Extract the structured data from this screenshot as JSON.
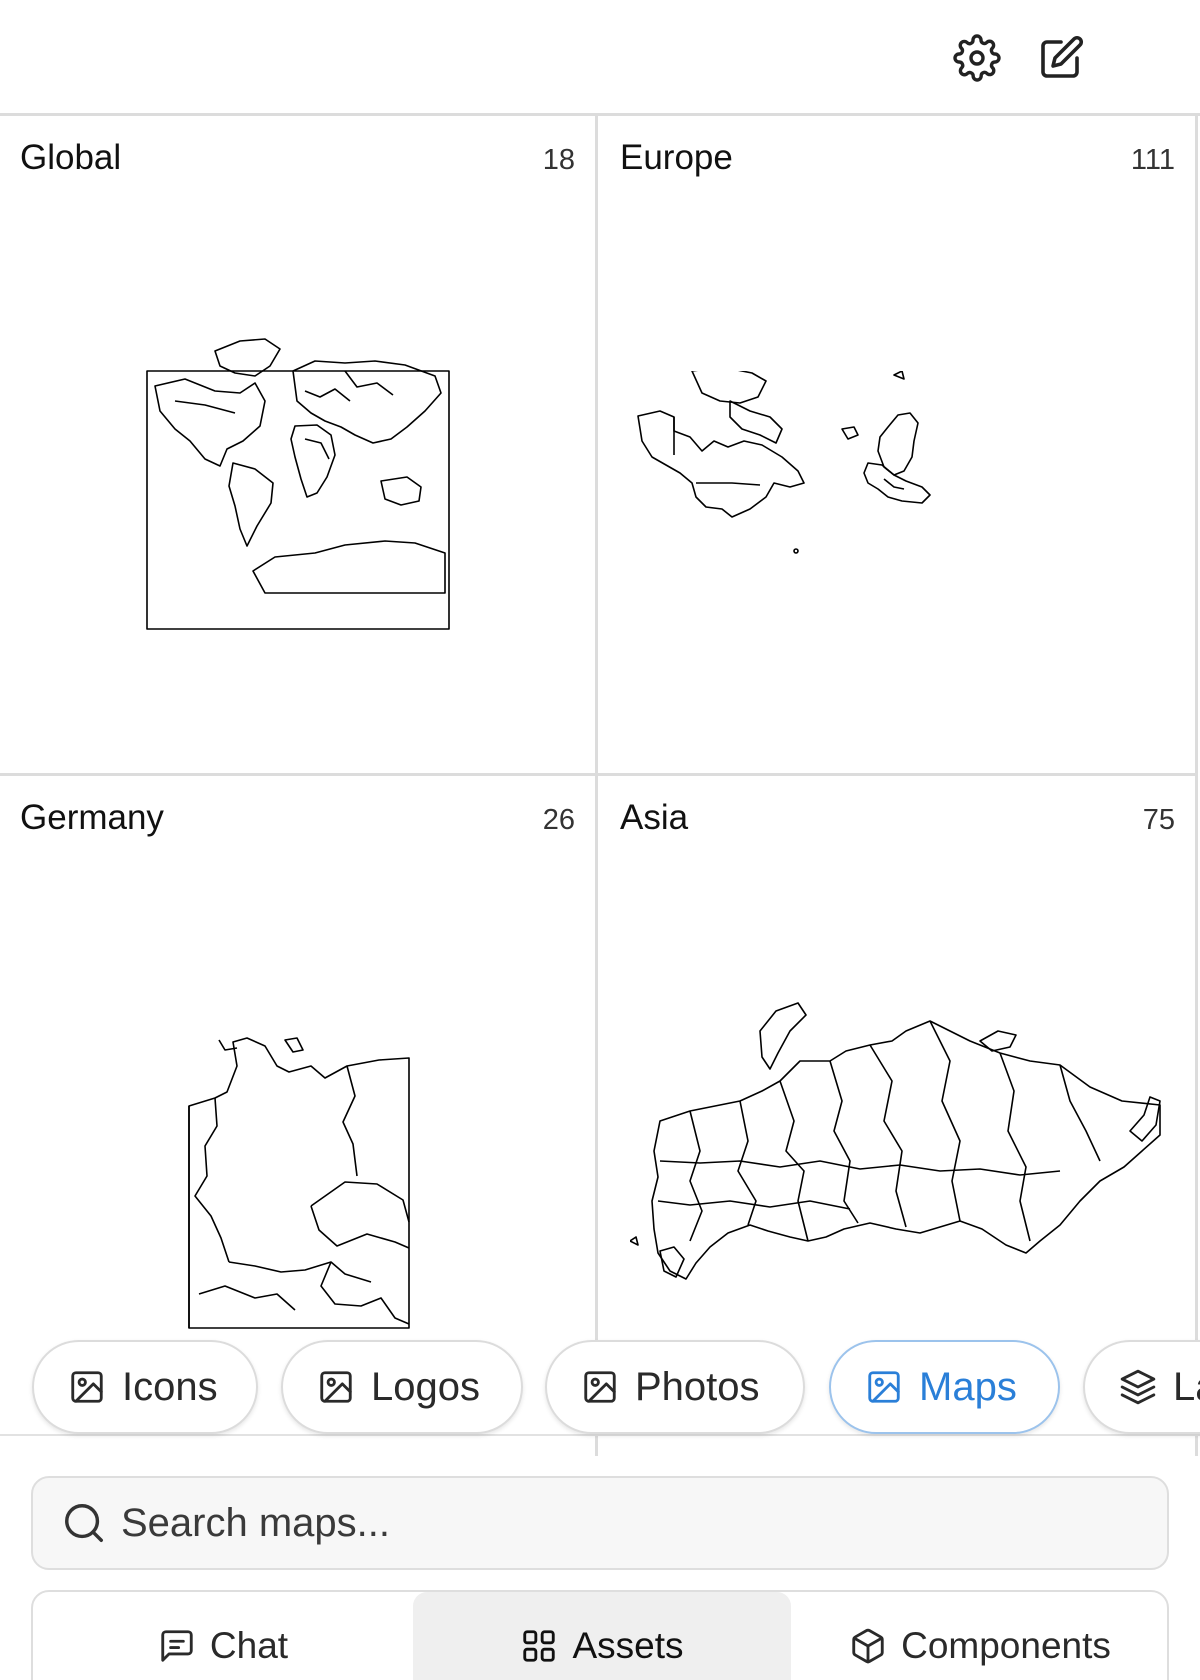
{
  "toolbar": {
    "settings_icon": "gear-icon",
    "compose_icon": "edit-icon"
  },
  "maps": [
    {
      "title": "Global",
      "count": "18"
    },
    {
      "title": "Europe",
      "count": "111"
    },
    {
      "title": "Germany",
      "count": "26"
    },
    {
      "title": "Asia",
      "count": "75"
    }
  ],
  "categories": [
    {
      "label": "Icons",
      "icon": "image-icon",
      "active": false
    },
    {
      "label": "Logos",
      "icon": "image-icon",
      "active": false
    },
    {
      "label": "Photos",
      "icon": "image-icon",
      "active": false
    },
    {
      "label": "Maps",
      "icon": "image-icon",
      "active": true
    },
    {
      "label": "La",
      "icon": "layers-icon",
      "active": false
    }
  ],
  "search": {
    "placeholder": "Search maps..."
  },
  "tabs": [
    {
      "label": "Chat",
      "icon": "message-icon",
      "active": false
    },
    {
      "label": "Assets",
      "icon": "grid-icon",
      "active": true
    },
    {
      "label": "Components",
      "icon": "box-icon",
      "active": false
    }
  ],
  "colors": {
    "accent": "#2a7fd8",
    "accent_border": "#9cc3ec",
    "divider": "#dcdcdc",
    "active_tab_bg": "#efefef"
  }
}
